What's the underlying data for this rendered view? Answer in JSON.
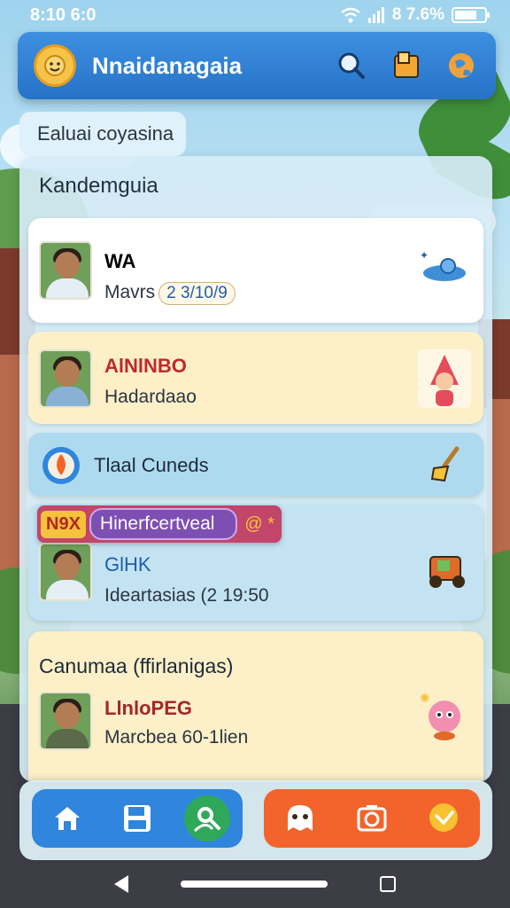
{
  "status_bar": {
    "time": "8:10 6:0",
    "battery_text": "8 7.6%",
    "battery_level": 0.76
  },
  "app_bar": {
    "title": "Nnaidanagaia",
    "icons": [
      "sun-logo-icon",
      "search-icon",
      "folder-icon",
      "globe-icon"
    ]
  },
  "section_chip": {
    "label": "Ealuai coyasina"
  },
  "panel": {
    "heading": "Kandemguia",
    "cards": [
      {
        "title": "WA",
        "subtitle": "Mavrs",
        "pill": "2 3/10/9",
        "title_color": "#1a1a1a",
        "deco_icon": "submarine-icon"
      },
      {
        "title": "AlNlNBO",
        "subtitle": "Hadardaao",
        "title_color": "#c0282c",
        "deco_icon": "girl-character-icon"
      },
      {
        "title": "Tlaal Cuneds",
        "deco_icon": "broom-icon",
        "icon": "fire-circle-icon"
      },
      {
        "title": "GlHK",
        "subtitle": "Ideartasias (2 19:50",
        "title_color": "#1f5fa8",
        "deco_icon": "tractor-icon"
      }
    ],
    "overlay_badge": {
      "code": "N9X",
      "text": "Hinerfcertveal",
      "icon_text": "@ *"
    },
    "bottom_section": {
      "heading": "Canumaa (ffirlanigas)",
      "card": {
        "title": "LlnloPEG",
        "subtitle": "Marcbea 60-1lien",
        "title_color": "#a3262a",
        "deco_icon": "cute-creature-icon"
      }
    }
  },
  "bottom_nav": {
    "left": [
      "home-icon",
      "save-icon",
      "search-user-icon"
    ],
    "right": [
      "ghost-icon",
      "camera-icon",
      "chat-bubble-icon"
    ]
  },
  "colors": {
    "app_bar": "#2f80d6",
    "nav_left": "#2f86dc",
    "nav_right": "#f2642b"
  }
}
